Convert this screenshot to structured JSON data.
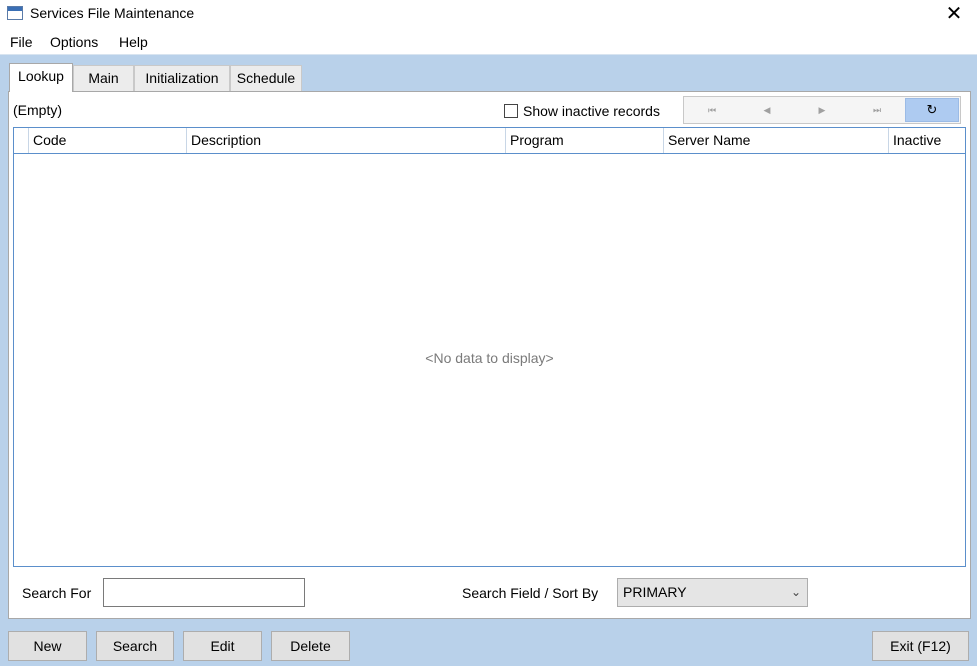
{
  "window": {
    "title": "Services File Maintenance",
    "close_glyph": "✕"
  },
  "menu": {
    "items": [
      "File",
      "Options",
      "Help"
    ]
  },
  "tabs": [
    "Lookup",
    "Main",
    "Initialization",
    "Schedule"
  ],
  "lookup": {
    "record_status": "(Empty)",
    "show_inactive_label": "Show inactive records",
    "show_inactive_checked": false,
    "nav": {
      "first": "⏮",
      "prev": "◀",
      "next": "▶",
      "last": "⏭",
      "refresh": "↻"
    },
    "columns": [
      "Code",
      "Description",
      "Program",
      "Server Name",
      "Inactive"
    ],
    "rows": [],
    "empty_message": "<No data to display>",
    "search_for_label": "Search For",
    "search_for_value": "",
    "sort_label": "Search Field / Sort By",
    "sort_value": "PRIMARY",
    "sort_chevron": "⌄"
  },
  "buttons": {
    "new": "New",
    "search": "Search",
    "edit": "Edit",
    "delete": "Delete",
    "exit": "Exit (F12)"
  },
  "colors": {
    "client_bg": "#b9d1ea",
    "grid_border": "#5b8fcb",
    "refresh_btn": "#aecbf1"
  }
}
